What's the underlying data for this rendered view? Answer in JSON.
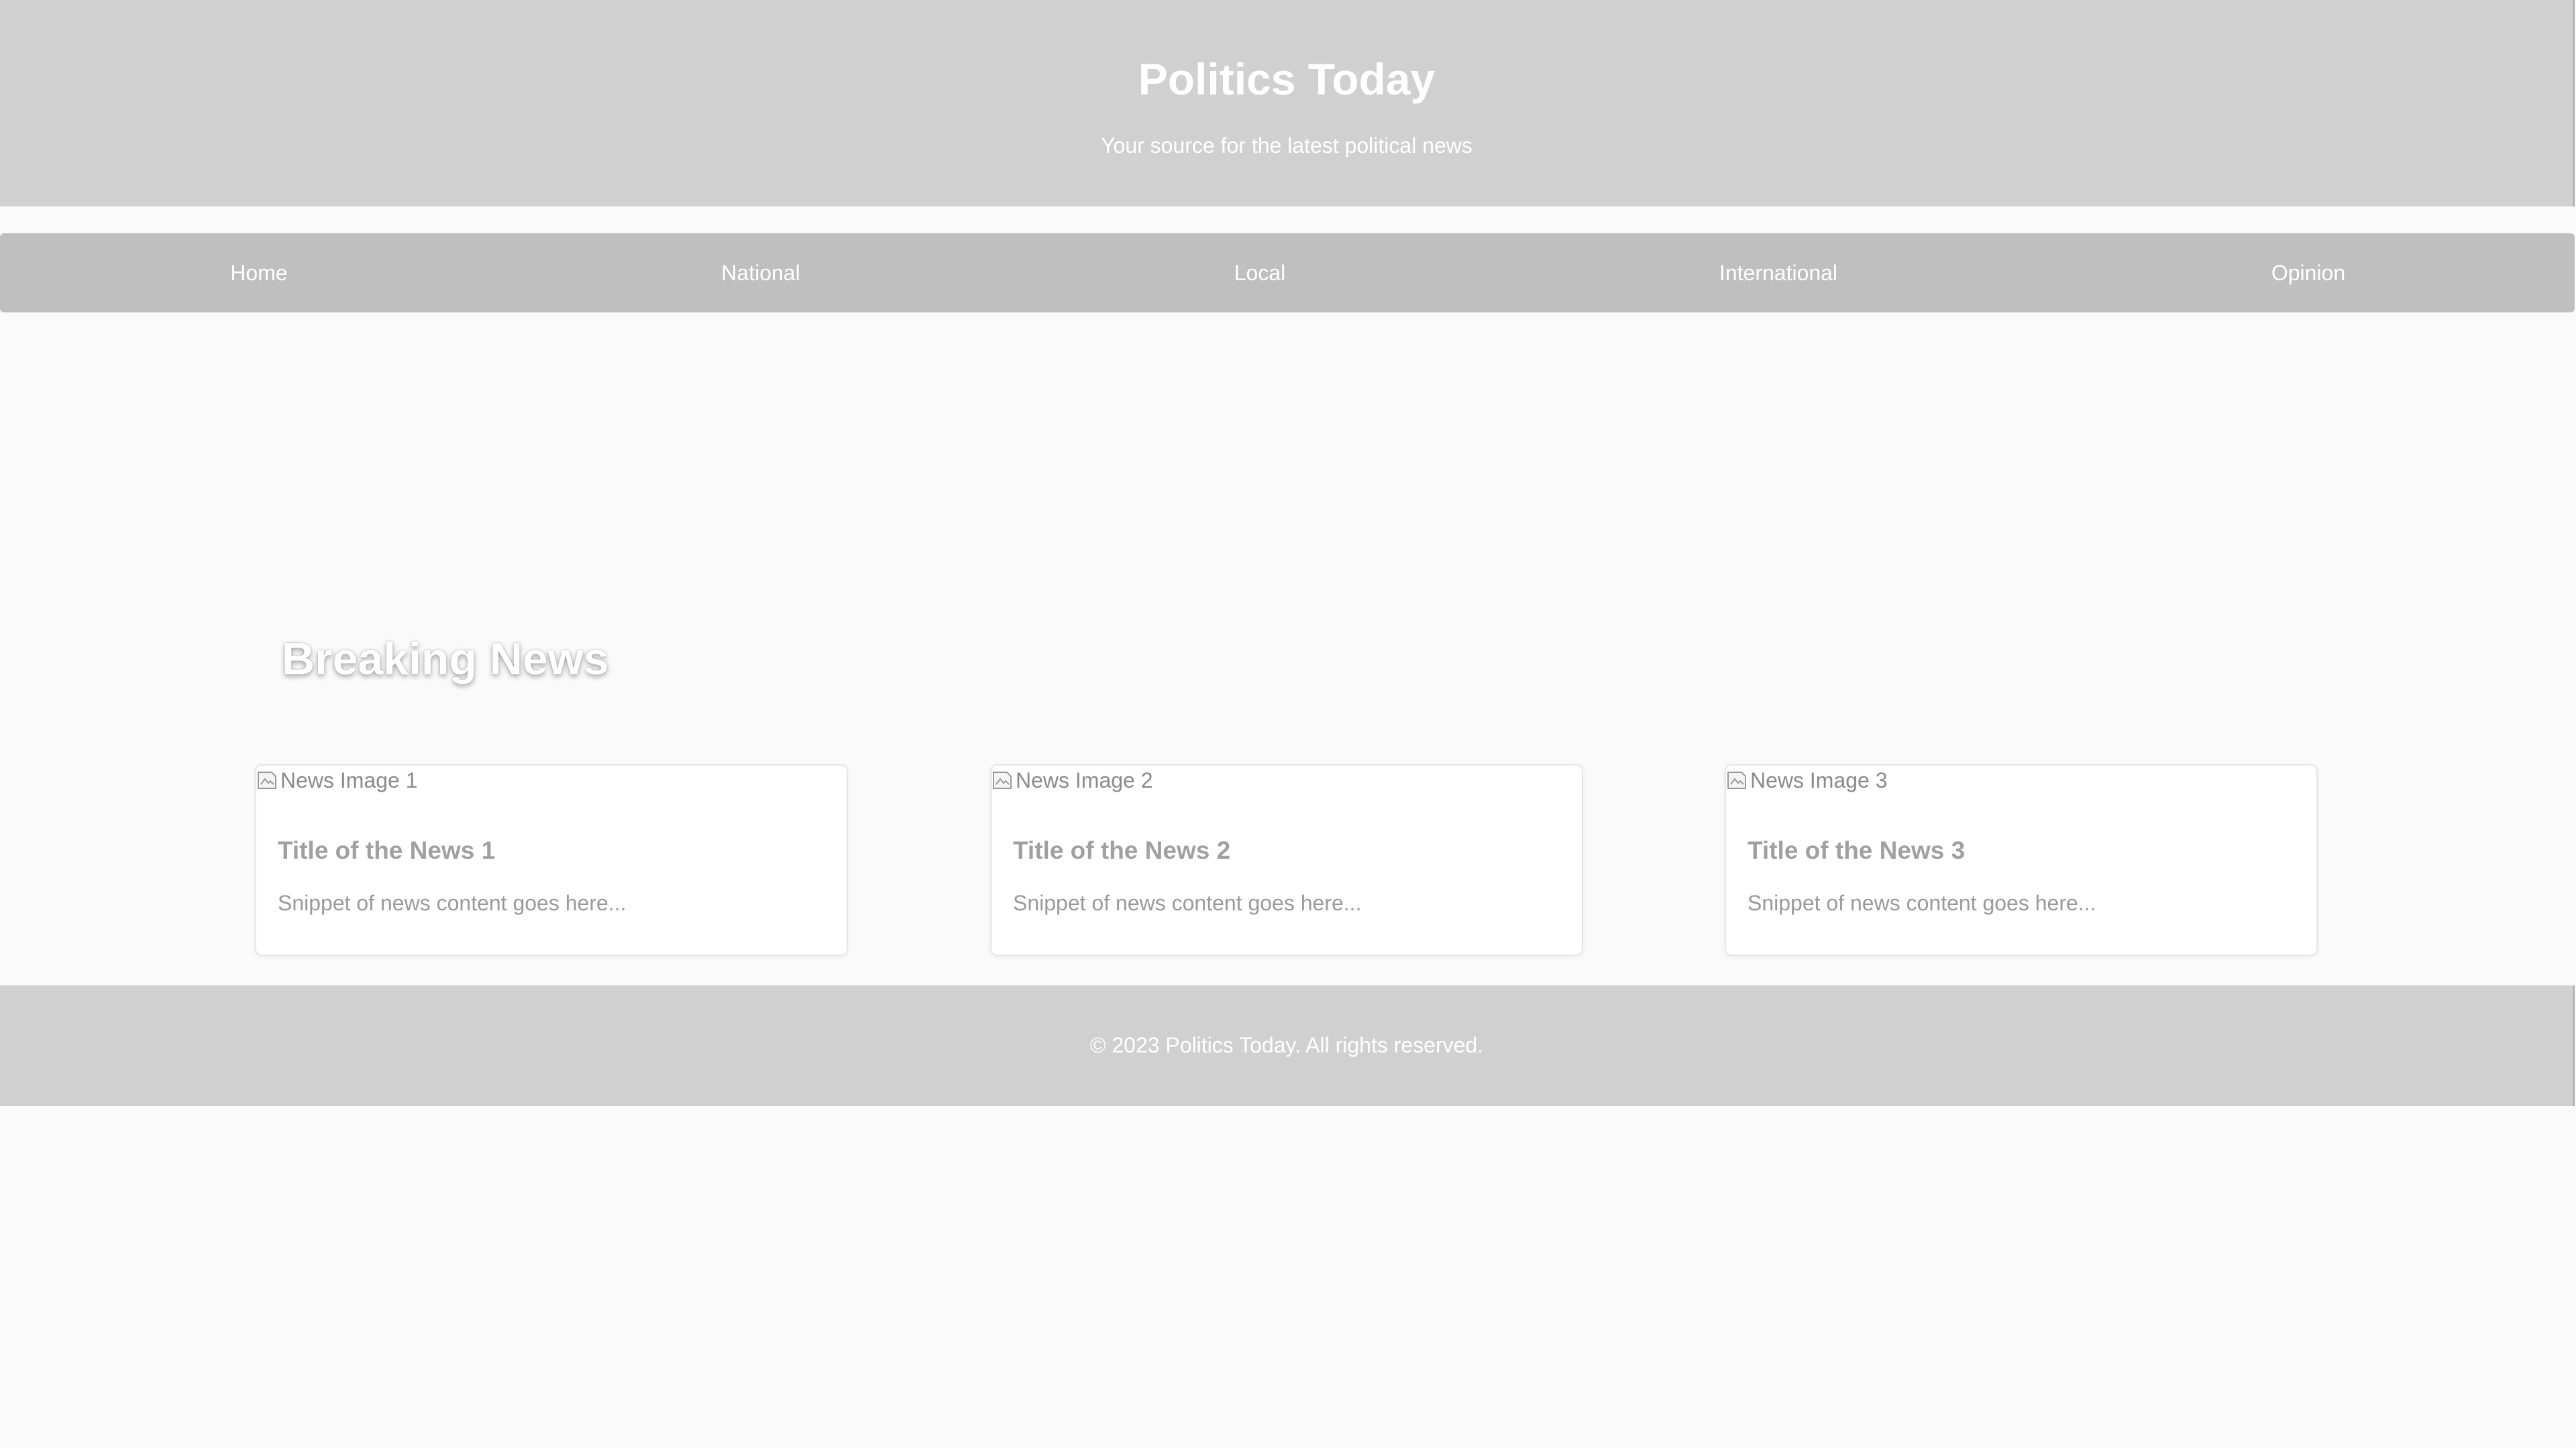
{
  "header": {
    "title": "Politics Today",
    "tagline": "Your source for the latest political news"
  },
  "nav": {
    "items": [
      {
        "label": "Home"
      },
      {
        "label": "National"
      },
      {
        "label": "Local"
      },
      {
        "label": "International"
      },
      {
        "label": "Opinion"
      }
    ]
  },
  "main": {
    "section_title": "Breaking News",
    "cards": [
      {
        "image_alt": "News Image 1",
        "title": "Title of the News 1",
        "snippet": "Snippet of news content goes here..."
      },
      {
        "image_alt": "News Image 2",
        "title": "Title of the News 2",
        "snippet": "Snippet of news content goes here..."
      },
      {
        "image_alt": "News Image 3",
        "title": "Title of the News 3",
        "snippet": "Snippet of news content goes here..."
      }
    ]
  },
  "footer": {
    "copyright": "© 2023 Politics Today. All rights reserved."
  },
  "colors": {
    "header_bg": "#d0d0d0",
    "nav_bg": "#bfbfbf",
    "page_bg": "#fafafa",
    "card_bg": "#ffffff",
    "header_text": "#ffffff",
    "card_text": "#a0a0a0"
  }
}
